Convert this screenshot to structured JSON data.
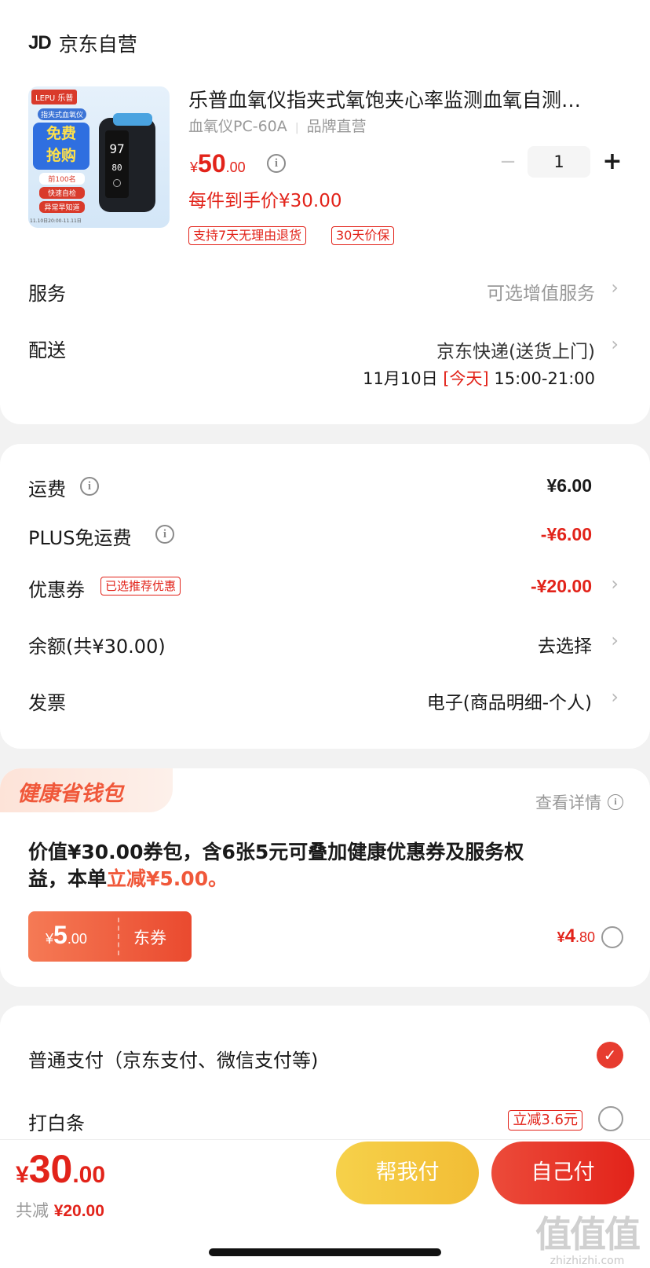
{
  "shop": {
    "logo": "JD",
    "name": "京东自营"
  },
  "product": {
    "title": "乐普血氧仪指夹式氧饱夹心率监测血氧自测…",
    "model": "血氧仪PC-60A",
    "brand": "品牌直营",
    "price_symbol": "¥",
    "price_int": "50",
    "price_dec": ".00",
    "unit_price": "每件到手价¥30.00",
    "quantity": "1",
    "minus": "−",
    "plus": "+",
    "tags": [
      "支持7天无理由退货",
      "30天价保"
    ],
    "image": {
      "brand": "LEPU 乐普",
      "sub": "指夹式血氧仪",
      "badge1": "免费",
      "badge2": "抢购",
      "pill1": "前100名",
      "pill2": "快速自检",
      "pill3": "异常早知道",
      "date": "11.10日20:00-11.11日",
      "screen1": "97",
      "screen2": "80"
    }
  },
  "service": {
    "label": "服务",
    "value": "可选增值服务"
  },
  "delivery": {
    "label": "配送",
    "value": "京东快递(送货上门)",
    "date": "11月10日",
    "today": "[今天]",
    "time": "15:00-21:00"
  },
  "fees": [
    {
      "label": "运费",
      "value": "¥6.00"
    },
    {
      "label": "PLUS免运费",
      "value": "-¥6.00"
    },
    {
      "label": "优惠券",
      "tag": "已选推荐优惠",
      "value": "-¥20.00"
    },
    {
      "label": "余额(共¥30.00)",
      "value": "去选择"
    },
    {
      "label": "发票",
      "value": "电子(商品明细-个人)"
    }
  ],
  "health": {
    "title": "健康省钱包",
    "detail": "查看详情",
    "desc1": "价值¥30.00券包，含6张5元可叠加健康优惠券及服务权",
    "desc2_black": "益，本单",
    "desc2_red": "立减¥5.00。",
    "coupon_symbol": "¥",
    "coupon_int": "5",
    "coupon_dec": ".00",
    "coupon_type": "东券",
    "price_symbol": "¥",
    "price_int": "4",
    "price_dec": ".80"
  },
  "payment": {
    "option1": "普通支付（京东支付、微信支付等)",
    "option2": "打白条",
    "option2_tag": "立减3.6元"
  },
  "footer": {
    "total_symbol": "¥",
    "total_int": "30",
    "total_dec": ".00",
    "saving_label": "共减",
    "saving_value": "¥20.00",
    "help_pay": "帮我付",
    "self_pay": "自己付"
  },
  "watermark": {
    "text": "值值值",
    "url": "zhizhizhi.com"
  },
  "colors": {
    "accent": "#e2231a",
    "help_btn": "#f5c73c",
    "self_btn": "#e73c2f"
  }
}
